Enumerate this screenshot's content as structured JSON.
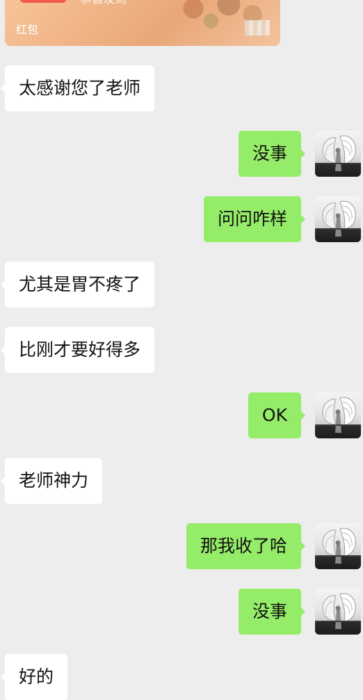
{
  "red_packet": {
    "greeting": "恭喜发财",
    "label": "红包"
  },
  "messages": [
    {
      "side": "left",
      "text": "太感谢您了老师"
    },
    {
      "side": "right",
      "text": "没事"
    },
    {
      "side": "right",
      "text": "问问咋样"
    },
    {
      "side": "left",
      "text": "尤其是胃不疼了"
    },
    {
      "side": "left",
      "text": "比刚才要好得多"
    },
    {
      "side": "right",
      "text": "OK"
    },
    {
      "side": "left",
      "text": "老师神力"
    },
    {
      "side": "right",
      "text": "那我收了哈"
    },
    {
      "side": "right",
      "text": "没事"
    },
    {
      "side": "left",
      "text": "好的"
    }
  ],
  "colors": {
    "background": "#ededed",
    "incoming_bubble": "#ffffff",
    "outgoing_bubble": "#95ec69",
    "red_packet": "#f0b486"
  },
  "icons": {
    "avatar": "angel-wing-statue-avatar",
    "red_packet": "red-packet-icon"
  }
}
